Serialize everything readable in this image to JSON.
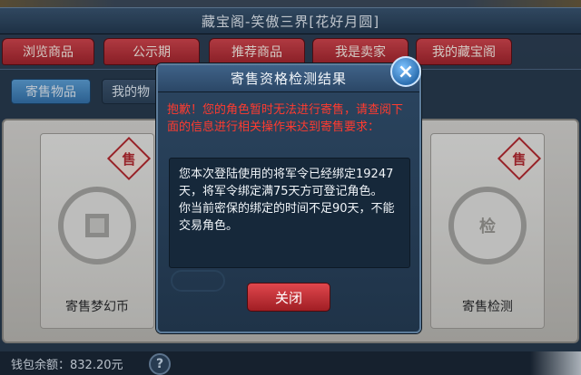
{
  "window": {
    "title": "藏宝阁-笑傲三界[花好月圆]"
  },
  "tabs": [
    {
      "label": "浏览商品"
    },
    {
      "label": "公示期"
    },
    {
      "label": "推荐商品"
    },
    {
      "label": "我是卖家"
    },
    {
      "label": "我的藏宝阁"
    }
  ],
  "subtabs": [
    {
      "label": "寄售物品",
      "active": true
    },
    {
      "label": "我的物",
      "active": false
    }
  ],
  "cards": [
    {
      "label": "寄售梦幻币",
      "badge": "售",
      "coin_glyph": ""
    },
    {
      "label": "寄售检测",
      "badge": "售",
      "coin_glyph": "检"
    }
  ],
  "footer": {
    "wallet": "钱包余额：832.20元",
    "help": "?"
  },
  "dialog": {
    "title": "寄售资格检测结果",
    "close_icon": "×",
    "warning": "抱歉！您的角色暂时无法进行寄售，请查阅下面的信息进行相关操作来达到寄售要求：",
    "messages": [
      "您本次登陆使用的将军令已经绑定19247天，将军令绑定满75天方可登记角色。",
      "你当前密保的绑定的时间不足90天，不能交易角色。"
    ],
    "button": "关闭"
  },
  "colors": {
    "tab_red": "#c8323a",
    "warning_red": "#ff3b2f",
    "subtab_blue": "#4a8ac4"
  }
}
